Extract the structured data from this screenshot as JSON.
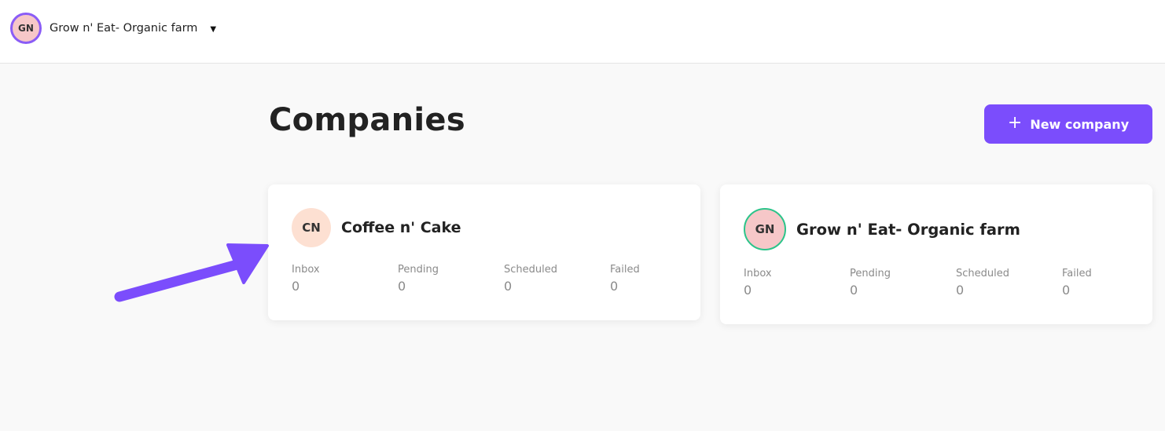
{
  "header": {
    "current_company": {
      "initials": "GN",
      "name": "Grow n' Eat- Organic farm"
    },
    "caret_icon": "caret-down-icon"
  },
  "page": {
    "title": "Companies",
    "new_button_label": "New company",
    "new_button_icon": "plus-icon",
    "accent_color": "#7b4dfc"
  },
  "companies": [
    {
      "initials": "CN",
      "name": "Coffee n' Cake",
      "avatar_color": "#fde0d2",
      "stats": [
        {
          "label": "Inbox",
          "value": "0"
        },
        {
          "label": "Pending",
          "value": "0"
        },
        {
          "label": "Scheduled",
          "value": "0"
        },
        {
          "label": "Failed",
          "value": "0"
        }
      ]
    },
    {
      "initials": "GN",
      "name": "Grow n' Eat- Organic farm",
      "avatar_color": "#f6c7c8",
      "avatar_ring_color": "#2cc48a",
      "stats": [
        {
          "label": "Inbox",
          "value": "0"
        },
        {
          "label": "Pending",
          "value": "0"
        },
        {
          "label": "Scheduled",
          "value": "0"
        },
        {
          "label": "Failed",
          "value": "0"
        }
      ]
    }
  ],
  "annotation": {
    "arrow_icon": "arrow-annotation-icon",
    "arrow_color": "#7b4dfc"
  }
}
